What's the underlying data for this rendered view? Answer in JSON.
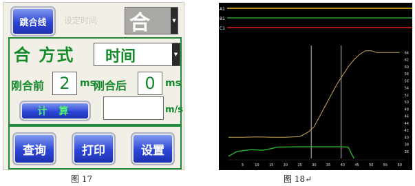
{
  "left_panel": {
    "trip_button": "跳合线",
    "faded_label": "设定时间",
    "state_select": "合",
    "mode_label": "合 方式",
    "mode_select": "时间",
    "before_label": "刚合前",
    "before_value": "2",
    "unit_ms": "ms",
    "after_label": "刚合后",
    "after_value": "0",
    "calc_button": "计 算",
    "speed_value": "",
    "speed_unit": "m/s",
    "query_button": "查询",
    "print_button": "打印",
    "settings_button": "设置",
    "caption": "图 17"
  },
  "right_panel": {
    "caption": "图 18↵"
  },
  "chart_data": {
    "type": "line",
    "title": "",
    "xlabel": "",
    "ylabel": "",
    "xlim": [
      0,
      62
    ],
    "ylim": [
      34,
      66
    ],
    "x_ticks": [
      "5",
      "10",
      "15",
      "20",
      "25",
      "30",
      "35",
      "40",
      "45",
      "50",
      "55",
      "60"
    ],
    "y_ticks": [
      "36",
      "38",
      "40",
      "42",
      "44",
      "46",
      "48",
      "50",
      "52",
      "54",
      "56",
      "58",
      "60",
      "62",
      "64"
    ],
    "channels": [
      {
        "name": "A1",
        "color": "#f0c020"
      },
      {
        "name": "B1",
        "color": "#28a028"
      },
      {
        "name": "C1",
        "color": "#e02020"
      }
    ],
    "cursors_x": [
      29,
      39.5
    ],
    "series": [
      {
        "color": "#c9a75a",
        "values": [
          [
            0,
            40
          ],
          [
            5,
            40
          ],
          [
            10,
            40.1
          ],
          [
            15,
            40
          ],
          [
            20,
            40
          ],
          [
            25,
            40.2
          ],
          [
            28,
            41.5
          ],
          [
            30,
            43
          ],
          [
            32,
            46
          ],
          [
            34,
            49
          ],
          [
            36,
            52
          ],
          [
            38,
            55
          ],
          [
            40,
            57.5
          ],
          [
            42,
            60
          ],
          [
            44,
            62
          ],
          [
            46,
            63.5
          ],
          [
            48,
            64.5
          ],
          [
            50,
            64.5
          ],
          [
            52,
            64
          ],
          [
            55,
            64
          ],
          [
            60,
            64
          ]
        ]
      },
      {
        "color": "#2cb82c",
        "values": [
          [
            0,
            34.6
          ],
          [
            3,
            36
          ],
          [
            8,
            36.5
          ],
          [
            12,
            36.3
          ],
          [
            15,
            36.8
          ],
          [
            17,
            37.2
          ],
          [
            25,
            37.3
          ],
          [
            30,
            37.3
          ],
          [
            40,
            37.3
          ],
          [
            42,
            37.2
          ],
          [
            43,
            35.5
          ],
          [
            44,
            34
          ]
        ]
      }
    ]
  }
}
